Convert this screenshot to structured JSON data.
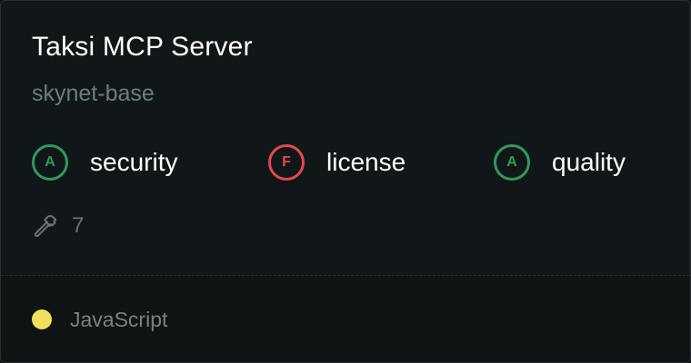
{
  "server": {
    "name": "Taksi MCP Server",
    "owner": "skynet-base"
  },
  "scores": [
    {
      "grade": "A",
      "label": "security",
      "status": "good"
    },
    {
      "grade": "F",
      "label": "license",
      "status": "bad"
    },
    {
      "grade": "A",
      "label": "quality",
      "status": "good"
    }
  ],
  "tools": {
    "icon": "hammer-icon",
    "count": "7"
  },
  "language": {
    "name": "JavaScript",
    "color": "#f1e05a"
  },
  "colors": {
    "grade_good": "#2e9a5c",
    "grade_bad": "#e5484d"
  }
}
